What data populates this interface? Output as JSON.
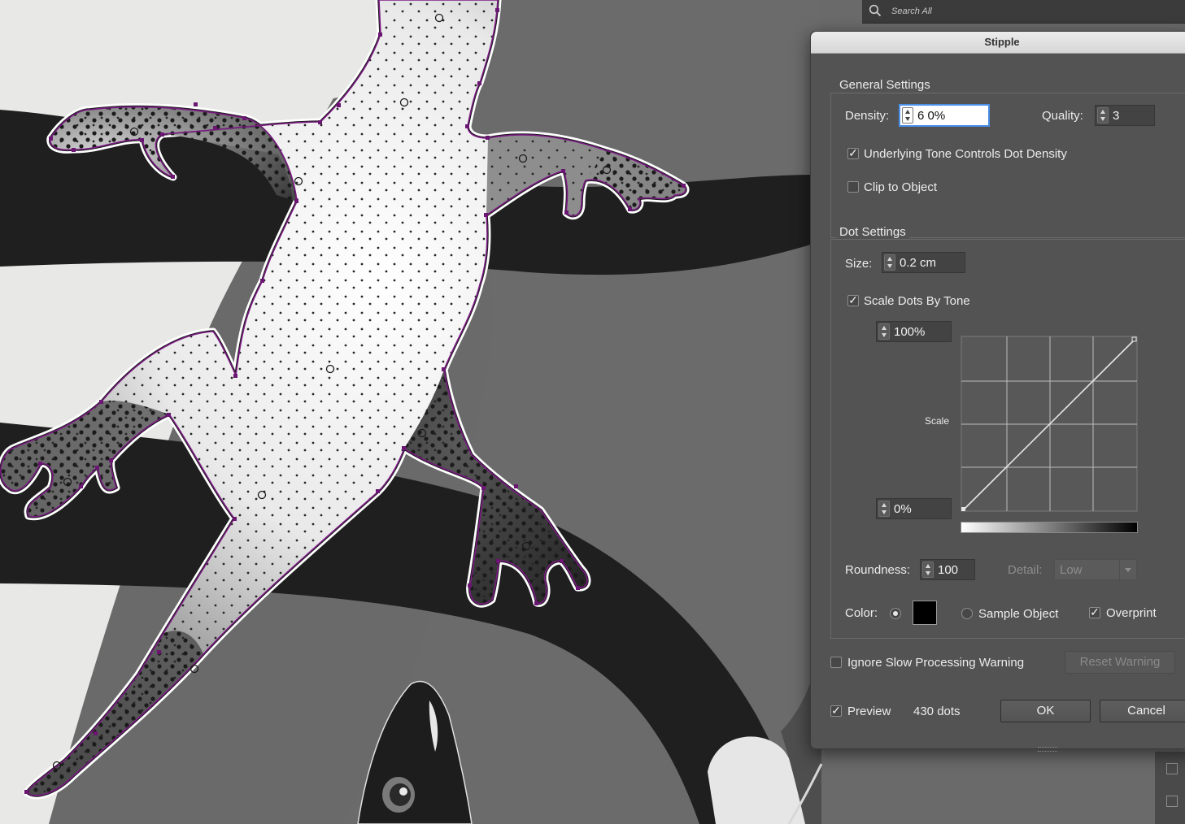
{
  "search": {
    "placeholder": "Search All"
  },
  "dialog": {
    "title": "Stipple",
    "general_settings": {
      "title": "General Settings",
      "density_label": "Density:",
      "density_value": "6 0%",
      "quality_label": "Quality:",
      "quality_value": "3",
      "underlying_tone_label": "Underlying Tone Controls Dot Density",
      "underlying_tone_checked": true,
      "clip_label": "Clip to Object",
      "clip_checked": false
    },
    "dot_settings": {
      "title": "Dot Settings",
      "size_label": "Size:",
      "size_value": "0.2 cm",
      "scale_by_tone_label": "Scale Dots By Tone",
      "scale_by_tone_checked": true,
      "scale_max_value": "100%",
      "scale_min_value": "0%",
      "scale_label": "Scale",
      "roundness_label": "Roundness:",
      "roundness_value": "100",
      "detail_label": "Detail:",
      "detail_value": "Low",
      "color_label": "Color:",
      "color_selected": true,
      "color_swatch": "#000000",
      "sample_object_label": "Sample Object",
      "sample_object_selected": false,
      "overprint_label": "Overprint",
      "overprint_checked": true
    },
    "ignore_warning_label": "Ignore Slow Processing Warning",
    "ignore_warning_checked": false,
    "reset_warning_label": "Reset Warning",
    "preview_label": "Preview",
    "preview_checked": true,
    "dot_count": "430 dots",
    "ok_label": "OK",
    "cancel_label": "Cancel"
  },
  "icons": {
    "search": "search-icon",
    "check": "✓"
  },
  "colors": {
    "selection_path": "#7a1a82",
    "panel_bg": "#535353",
    "focus_ring": "#4a8fe8"
  }
}
